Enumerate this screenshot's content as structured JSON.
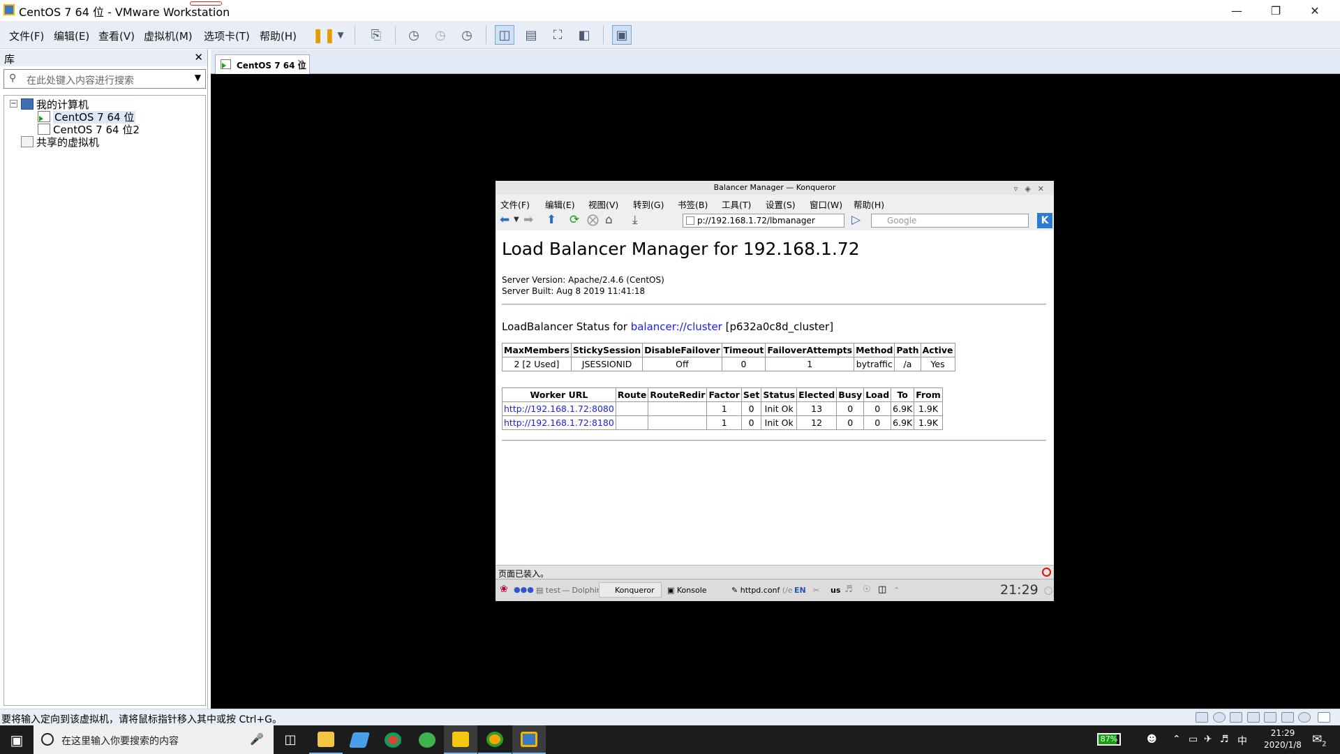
{
  "window": {
    "title": "CentOS 7 64 位 - VMware Workstation"
  },
  "menu": [
    "文件(F)",
    "编辑(E)",
    "查看(V)",
    "虚拟机(M)",
    "选项卡(T)",
    "帮助(H)"
  ],
  "library": {
    "title": "库",
    "search_placeholder": "在此处键入内容进行搜索",
    "tree": {
      "root": "我的计算机",
      "vms": [
        "CentOS 7 64 位",
        "CentOS 7 64 位2"
      ],
      "shared": "共享的虚拟机"
    }
  },
  "vm_tab": {
    "label": "CentOS 7 64 位"
  },
  "konqueror": {
    "title": "Balancer Manager — Konqueror",
    "menu": [
      "文件(F)",
      "编辑(E)",
      "视图(V)",
      "转到(G)",
      "书签(B)",
      "工具(T)",
      "设置(S)",
      "窗口(W)",
      "帮助(H)"
    ],
    "url": "p://192.168.1.72/lbmanager",
    "search_placeholder": "Google",
    "page": {
      "heading": "Load Balancer Manager for 192.168.1.72",
      "server_version": "Server Version: Apache/2.4.6 (CentOS)",
      "server_built": "Server Built: Aug 8 2019 11:41:18",
      "status_prefix": "LoadBalancer Status for ",
      "status_link": "balancer://cluster",
      "status_suffix": "[p632a0c8d_cluster]",
      "balancer_table": {
        "headers": [
          "MaxMembers",
          "StickySession",
          "DisableFailover",
          "Timeout",
          "FailoverAttempts",
          "Method",
          "Path",
          "Active"
        ],
        "row": [
          "2 [2 Used]",
          "JSESSIONID",
          "Off",
          "0",
          "1",
          "bytraffic",
          "/a",
          "Yes"
        ]
      },
      "worker_table": {
        "headers": [
          "Worker URL",
          "Route",
          "RouteRedir",
          "Factor",
          "Set",
          "Status",
          "Elected",
          "Busy",
          "Load",
          "To",
          "From"
        ],
        "rows": [
          [
            "http://192.168.1.72:8080",
            "",
            "",
            "1",
            "0",
            "Init Ok",
            "13",
            "0",
            "0",
            "6.9K",
            "1.9K"
          ],
          [
            "http://192.168.1.72:8180",
            "",
            "",
            "1",
            "0",
            "Init Ok",
            "12",
            "0",
            "0",
            "6.9K",
            "1.9K"
          ]
        ]
      }
    },
    "statusbar": "页面已装入。",
    "panel": {
      "task_test": "test",
      "task_dolphin": "— Dolphin",
      "task_konqueror": "Konqueror",
      "task_konsole": "Konsole",
      "task_httpd": "httpd.conf",
      "task_httpd_path": "(/e",
      "lang": "EN",
      "layout": "us",
      "clock": "21:29"
    }
  },
  "vm_status_message": "要将输入定向到该虚拟机，请将鼠标指针移入其中或按 Ctrl+G。",
  "taskbar": {
    "search_placeholder": "在这里输入你要搜索的内容",
    "battery": "87%",
    "battery_level": 0.87,
    "ime": "中",
    "time": "21:29",
    "date": "2020/1/8",
    "notifications": "2"
  }
}
